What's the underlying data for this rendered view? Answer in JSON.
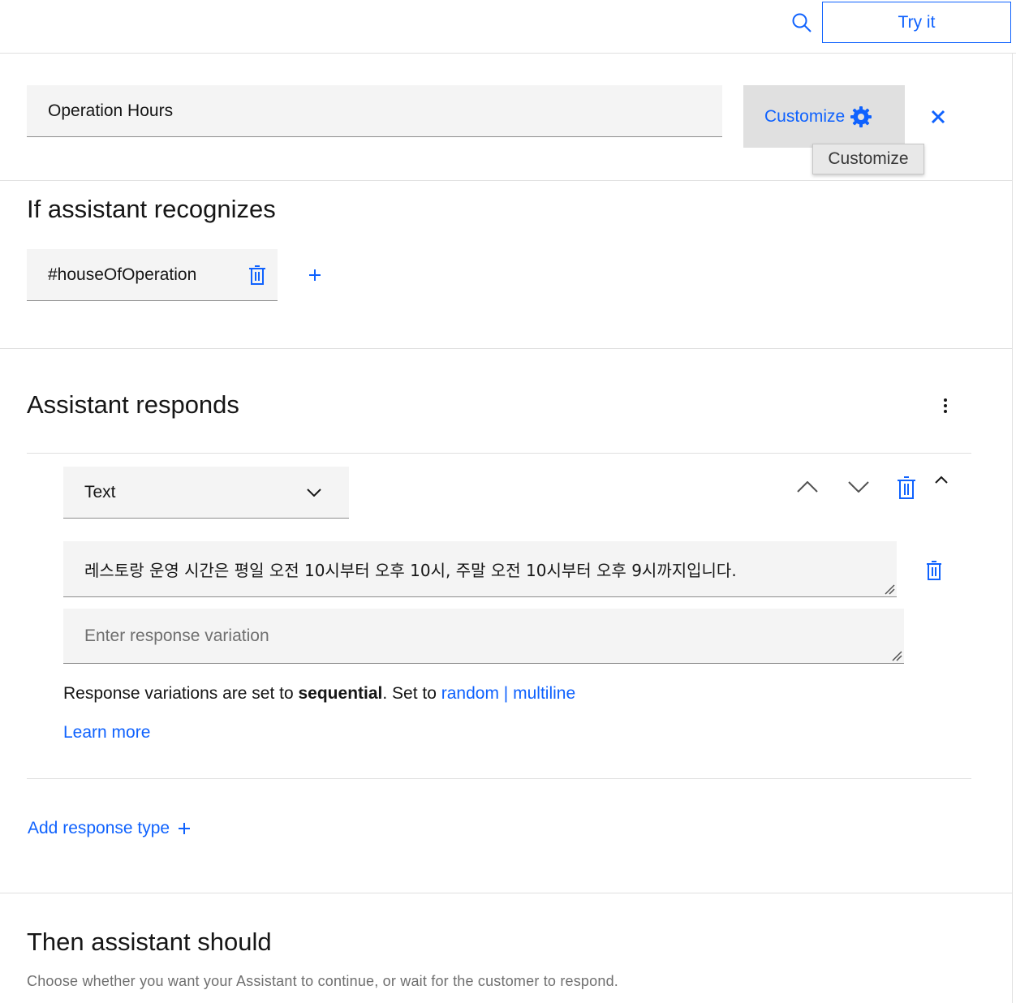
{
  "topbar": {
    "try_it_label": "Try it"
  },
  "node": {
    "name_value": "Operation Hours",
    "customize_label": "Customize",
    "tooltip": "Customize"
  },
  "recognizes": {
    "title": "If assistant recognizes",
    "condition": "#houseOfOperation"
  },
  "responds": {
    "title": "Assistant responds",
    "response_type": "Text",
    "response_text": "레스토랑 운영 시간은 평일 오전 10시부터 오후 10시, 주말 오전 10시부터 오후 9시까지입니다.",
    "variation_placeholder": "Enter response variation",
    "variations_prefix": "Response variations are set to ",
    "variations_mode": "sequential",
    "variations_middle": ". Set to ",
    "random_label": "random",
    "separator": "|",
    "multiline_label": "multiline",
    "learn_more": "Learn more",
    "add_response_type": "Add response type"
  },
  "then": {
    "title": "Then assistant should",
    "hint": "Choose whether you want your Assistant to continue, or wait for the customer to respond."
  },
  "colors": {
    "accent": "#0f62fe",
    "field_bg": "#f4f4f4",
    "divider": "#e0e0e0"
  }
}
